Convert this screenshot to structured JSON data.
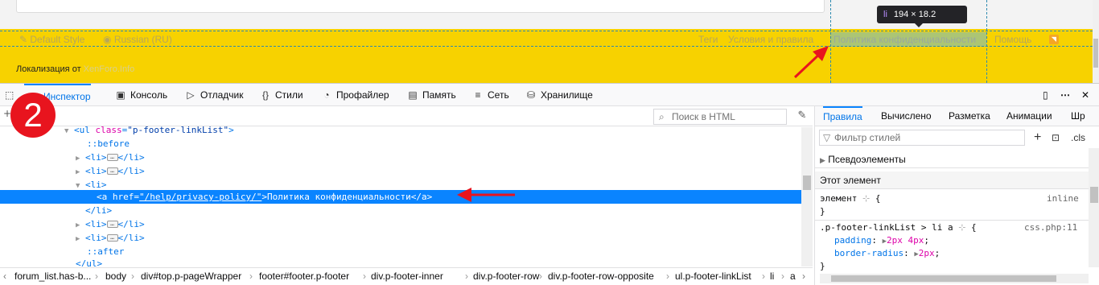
{
  "page": {
    "footer": {
      "style_label": "Default Style",
      "language_label": "Russian (RU)",
      "links": [
        "Теги",
        "Условия и правила",
        "Политика конфиденциальности",
        "Помощь"
      ],
      "localization_prefix": "Локализация от",
      "localization_link": "XenForo.Info",
      "accent_color": "#f7d200"
    },
    "tooltip": {
      "tag": "li",
      "size": "194 × 18.2"
    }
  },
  "devtools": {
    "tabs": [
      {
        "label": "Инспектор",
        "icon": "inspector-icon"
      },
      {
        "label": "Консоль",
        "icon": "console-icon"
      },
      {
        "label": "Отладчик",
        "icon": "debugger-icon"
      },
      {
        "label": "Стили",
        "icon": "styles-icon"
      },
      {
        "label": "Профайлер",
        "icon": "profiler-icon"
      },
      {
        "label": "Память",
        "icon": "memory-icon"
      },
      {
        "label": "Сеть",
        "icon": "network-icon"
      },
      {
        "label": "Хранилище",
        "icon": "storage-icon"
      }
    ],
    "search_placeholder": "Поиск в HTML",
    "markup": [
      {
        "text": "<ul class=\"p-footer-linkList\">"
      },
      {
        "text": "::before"
      },
      {
        "text": "<li>"
      },
      {
        "text": "</li>"
      },
      {
        "text": "<a href=\"/help/privacy-policy/\">Политика конфиденциальности</a>"
      }
    ],
    "breadcrumbs": [
      "forum_list.has-b...",
      "body",
      "div#top.p-pageWrapper",
      "footer#footer.p-footer",
      "div.p-footer-inner",
      "div.p-footer-row",
      "div.p-footer-row-opposite",
      "ul.p-footer-linkList",
      "li",
      "a"
    ],
    "rules": {
      "tabs": [
        "Правила",
        "Вычислено",
        "Разметка",
        "Анимации",
        "Шр"
      ],
      "filter_placeholder": "Фильтр стилей",
      "cls_label": ".cls",
      "pseudo_label": "Псевдоэлементы",
      "this_element_label": "Этот элемент",
      "element_selector": "элемент",
      "inline_label": "inline",
      "rule_selector": ".p-footer-linkList > li a",
      "rule_source": "css.php:11",
      "decls": [
        {
          "prop": "padding",
          "value": "2px 4px"
        },
        {
          "prop": "border-radius",
          "value": "2px"
        }
      ]
    }
  },
  "annotation": {
    "badge_number": "2",
    "arrow_color": "#e8141e"
  }
}
